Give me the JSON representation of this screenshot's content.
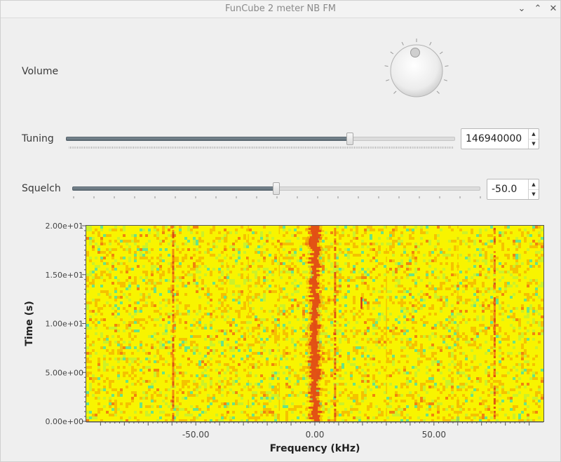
{
  "window": {
    "title": "FunCube  2 meter NB FM",
    "minimize_glyph": "⌄",
    "maximize_glyph": "⌃",
    "close_glyph": "✕"
  },
  "volume": {
    "label": "Volume",
    "level": 0.0
  },
  "tuning": {
    "label": "Tuning",
    "value": "146940000",
    "level": 0.73
  },
  "squelch": {
    "label": "Squelch",
    "value": "-50.0",
    "level": 0.5
  },
  "spin": {
    "up_glyph": "▲",
    "down_glyph": "▼"
  },
  "chart_data": {
    "type": "heatmap",
    "title": "",
    "xlabel": "Frequency (kHz)",
    "ylabel": "Time (s)",
    "xlim": [
      -96,
      96
    ],
    "ylim": [
      0,
      20
    ],
    "x_ticks": [
      -50,
      0,
      50
    ],
    "x_tick_labels": [
      "-50.00",
      "0.00",
      "50.00"
    ],
    "y_ticks": [
      0,
      5,
      10,
      15,
      20
    ],
    "y_tick_labels": [
      "0.00e+00",
      "5.00e+00",
      "1.00e+01",
      "1.50e+01",
      "2.00e+01"
    ],
    "signal_lines_khz": [
      -59.5,
      0,
      8.5,
      75.5
    ],
    "weak_lines_khz": [
      -37,
      -28,
      -15,
      30,
      60
    ],
    "short_burst": {
      "x_khz": 19.5,
      "y_range": [
        11.5,
        12.7
      ]
    },
    "colormap": [
      "#4fe0a0",
      "#c4f030",
      "#f8f400",
      "#f4b800",
      "#f07010",
      "#d83018"
    ],
    "grid": false
  }
}
